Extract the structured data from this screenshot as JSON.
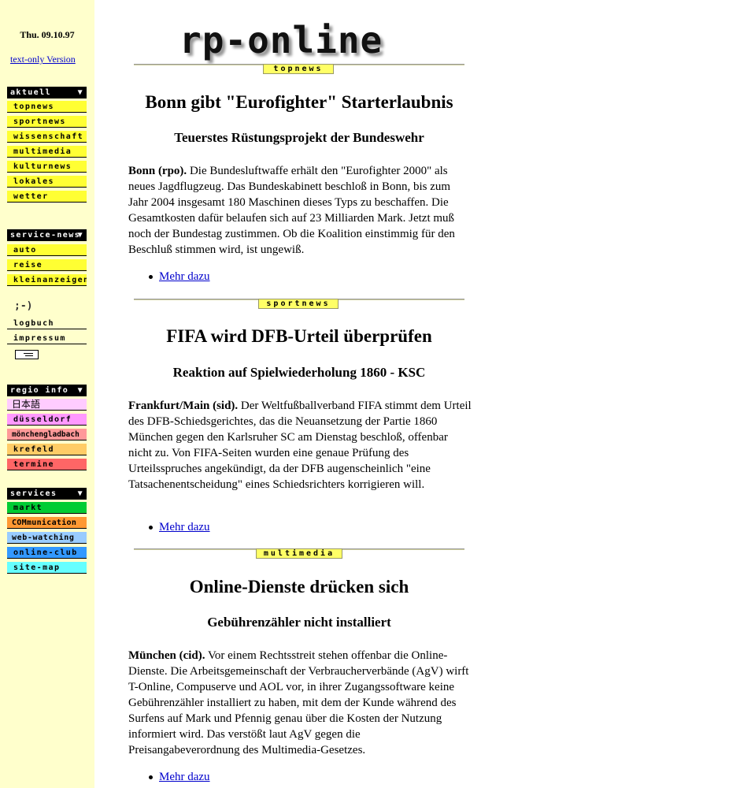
{
  "sidebar": {
    "date": "Thu. 09.10.97",
    "text_only": "text-only Version",
    "aktuell": {
      "header": "aktuell",
      "items": [
        "topnews",
        "sportnews",
        "wissenschaft",
        "multimedia",
        "kulturnews",
        "lokales",
        "wetter"
      ]
    },
    "service_news": {
      "header": "service-news",
      "items": [
        "auto",
        "reise",
        "kleinanzeigen"
      ]
    },
    "misc": {
      "smiley": ";-)",
      "items": [
        "logbuch",
        "impressum"
      ]
    },
    "regio": {
      "header": "regio info",
      "items": [
        "日本語",
        "düsseldorf",
        "mönchengladbach",
        "krefeld",
        "termine"
      ]
    },
    "services": {
      "header": "services",
      "items": [
        "markt",
        "COMmunication",
        "web-watching",
        "online-club",
        "site-map"
      ]
    }
  },
  "header": {
    "logo": "rp-online"
  },
  "articles": [
    {
      "section": "topnews",
      "headline": "Bonn gibt \"Eurofighter\" Starterlaubnis",
      "subheadline": "Teuerstes Rüstungsprojekt der Bundeswehr",
      "dateline": "Bonn (rpo).",
      "text": "Die Bundesluftwaffe erhält den \"Eurofighter 2000\" als neues Jagdflugzeug. Das Bundeskabinett beschloß in Bonn, bis zum Jahr 2004 insgesamt 180 Maschinen dieses Typs zu beschaffen. Die Gesamtkosten dafür belaufen sich auf 23 Milliarden Mark. Jetzt muß noch der Bundestag zustimmen. Ob die Koalition einstimmig für den Beschluß stimmen wird, ist ungewiß.",
      "more": "Mehr dazu"
    },
    {
      "section": "sportnews",
      "headline": "FIFA wird DFB-Urteil überprüfen",
      "subheadline": "Reaktion auf Spielwiederholung 1860 - KSC",
      "dateline": "Frankfurt/Main (sid).",
      "text": "Der Weltfußballverband FIFA stimmt dem Urteil des DFB-Schiedsgerichtes, das die Neuansetzung der Partie 1860 München gegen den Karlsruher SC am Dienstag beschloß, offenbar nicht zu. Von FIFA-Seiten wurden eine genaue Prüfung des Urteilsspruches angekündigt, da der DFB augenscheinlich \"eine Tatsachenentscheidung\" eines Schiedsrichters korrigieren will.",
      "more": "Mehr dazu"
    },
    {
      "section": "multimedia",
      "headline": "Online-Dienste drücken sich",
      "subheadline": "Gebührenzähler nicht installiert",
      "dateline": "München (cid).",
      "text": "Vor einem Rechtsstreit stehen offenbar die Online-Dienste. Die Arbeitsgemeinschaft der Verbraucherverbände (AgV) wirft T-Online, Compuserve und AOL vor, in ihrer Zugangssoftware keine Gebührenzähler installiert zu haben, mit dem der Kunde während des Surfens auf Mark und Pfennig genau über die Kosten der Nutzung informiert wird. Das verstößt laut AgV gegen die Preisangabeverordnung des Multimedia-Gesetzes.",
      "more": "Mehr dazu"
    }
  ],
  "colors": {
    "sidebar_bg": "#ffffcc",
    "yellow": "#ffff33",
    "pink": "#ffccff",
    "magenta": "#ff99ff",
    "salmon": "#ff9999",
    "orange": "#ffcc66",
    "red": "#ff6666",
    "green": "#00cc33",
    "orange2": "#ff9933",
    "lightblue": "#99ccff",
    "blue": "#3399ff",
    "cyan": "#66ffff",
    "link": "#0000cc"
  }
}
